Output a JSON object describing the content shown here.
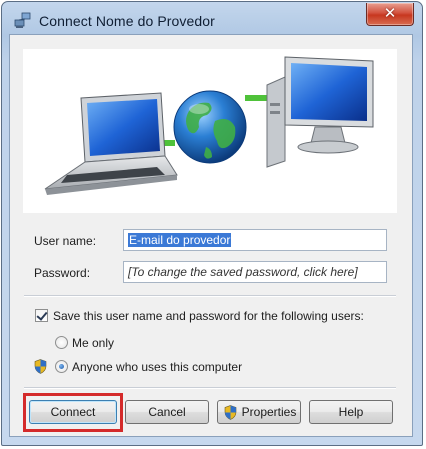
{
  "window": {
    "title": "Connect Nome do Provedor",
    "close_glyph": "✕"
  },
  "form": {
    "username_label": "User name:",
    "username_value": "E-mail do provedor",
    "password_label": "Password:",
    "password_value": "[To change the saved password, click here]",
    "save_checkbox_label": "Save this user name and password for the following users:",
    "save_checked": true,
    "radio_me_only": "Me only",
    "radio_anyone": "Anyone who uses this computer",
    "selected_radio": "Anyone who uses this computer"
  },
  "buttons": {
    "connect": "Connect",
    "cancel": "Cancel",
    "properties": "Properties",
    "help": "Help"
  },
  "icons": {
    "title": "network-connection-icon",
    "uac": "uac-shield-icon",
    "banner": [
      "laptop-icon",
      "globe-icon",
      "desktop-computer-icon"
    ]
  },
  "colors": {
    "highlight": "#d42a2a",
    "selection": "#3b79d6",
    "connector": "#4fc23a"
  }
}
